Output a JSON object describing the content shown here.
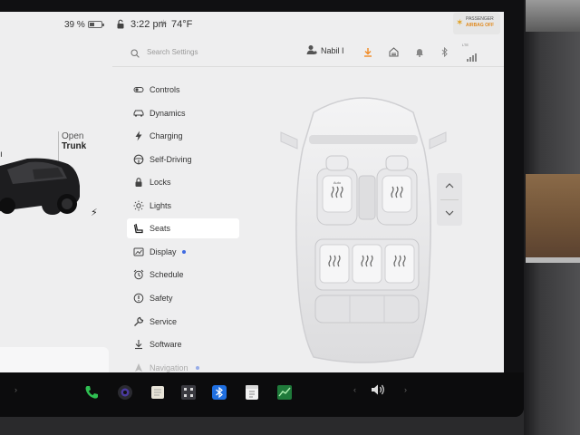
{
  "status_bar": {
    "battery_percent": "39 %",
    "battery_level": 0.39,
    "time": "3:22 pm",
    "temperature": "74°F",
    "airbag_line1": "PASSENGER",
    "airbag_line2": "AIRBAG OFF"
  },
  "car_panel": {
    "trunk_label_line1": "Open",
    "trunk_label_line2": "Trunk"
  },
  "settings": {
    "search_placeholder": "Search Settings",
    "profile_name": "Nabil I",
    "lte_label": "LTE",
    "nav_items": [
      {
        "label": "Controls",
        "icon": "toggle-icon",
        "active": false
      },
      {
        "label": "Dynamics",
        "icon": "car-icon",
        "active": false
      },
      {
        "label": "Charging",
        "icon": "lightning-icon",
        "active": false
      },
      {
        "label": "Self-Driving",
        "icon": "steering-wheel-icon",
        "active": false
      },
      {
        "label": "Locks",
        "icon": "lock-icon",
        "active": false
      },
      {
        "label": "Lights",
        "icon": "sun-icon",
        "active": false
      },
      {
        "label": "Seats",
        "icon": "seat-icon",
        "active": true
      },
      {
        "label": "Display",
        "icon": "display-icon",
        "active": false,
        "dot": true
      },
      {
        "label": "Schedule",
        "icon": "alarm-clock-icon",
        "active": false
      },
      {
        "label": "Safety",
        "icon": "alert-circle-icon",
        "active": false
      },
      {
        "label": "Service",
        "icon": "wrench-icon",
        "active": false
      },
      {
        "label": "Software",
        "icon": "download-icon",
        "active": false
      },
      {
        "label": "Navigation",
        "icon": "navigation-arrow-icon",
        "active": false,
        "dot": true
      }
    ]
  },
  "seats": {
    "driver_seat_label": "Auto"
  },
  "dock": {
    "apps": [
      "phone-icon",
      "camera-icon",
      "notepad-icon",
      "toybox-icon",
      "bluetooth-icon",
      "calendar-icon",
      "stocks-icon"
    ]
  },
  "colors": {
    "accent": "#3e6ae1",
    "download_orange": "#f08a24",
    "active_background": "#ffffff"
  }
}
